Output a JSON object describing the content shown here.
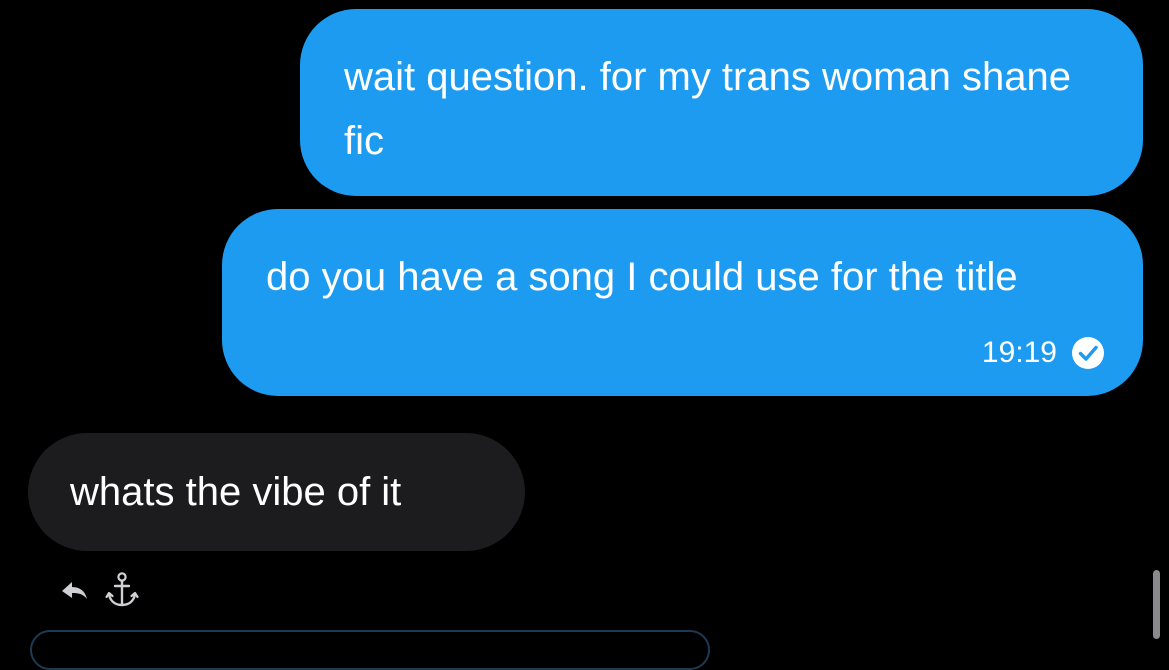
{
  "conversation": {
    "messages": [
      {
        "direction": "outgoing",
        "text": "wait question. for my trans woman shane fic"
      },
      {
        "direction": "outgoing",
        "text": "do you have a song I could use for the title",
        "timestamp": "19:19",
        "status_icon": "read-check-icon"
      },
      {
        "direction": "incoming",
        "text": "whats the vibe of it"
      }
    ],
    "actions": {
      "icons": [
        "reply-icon",
        "anchor-icon"
      ]
    }
  },
  "colors": {
    "background": "#000000",
    "outgoing_bubble": "#1d9bf0",
    "incoming_bubble": "#1c1c1e",
    "text": "#ffffff"
  }
}
